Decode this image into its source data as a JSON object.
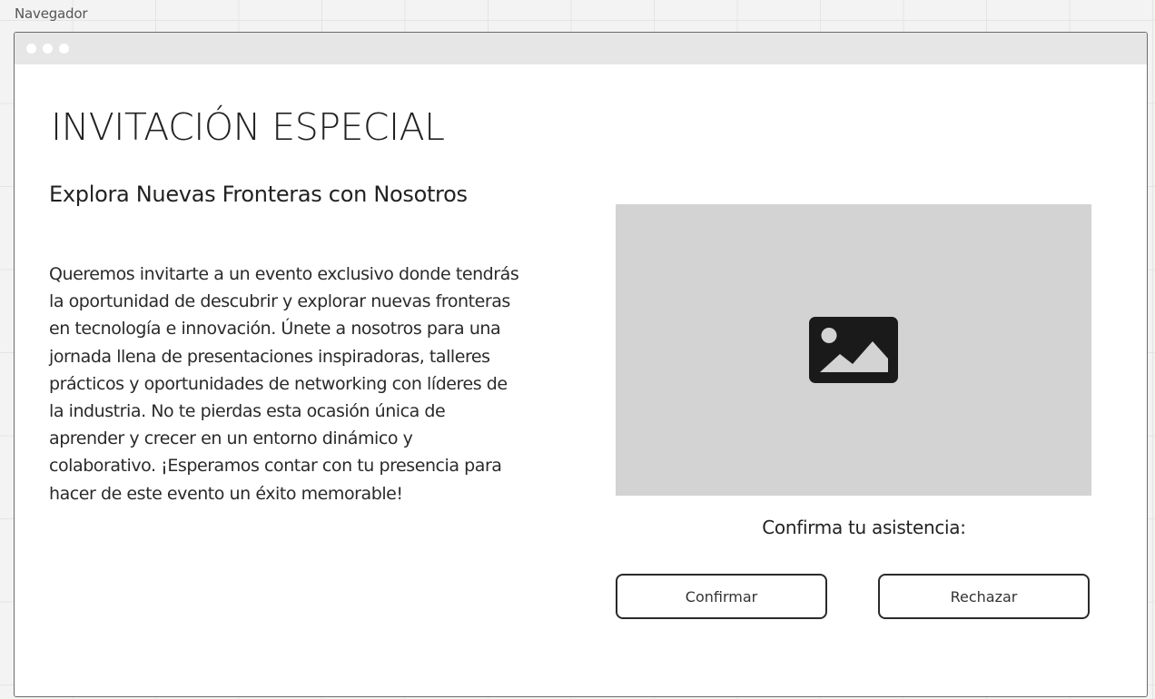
{
  "canvas": {
    "label": "Navegador"
  },
  "page": {
    "title": "INVITACIÓN ESPECIAL",
    "subtitle": "Explora Nuevas Fronteras con Nosotros",
    "body": "Queremos invitarte a un evento exclusivo donde tendrás la oportunidad de descubrir y explorar nuevas fronteras en tecnología e innovación. Únete a nosotros para una jornada llena de presentaciones inspiradoras, talleres prácticos y oportunidades de networking con líderes de la industria. No te pierdas esta ocasión única de aprender y crecer en un entorno dinámico y colaborativo. ¡Esperamos contar con tu presencia para hacer de este evento un éxito memorable!",
    "image_icon": "image-icon",
    "confirm_prompt": "Confirma tu asistencia:",
    "confirm_button": "Confirmar",
    "reject_button": "Rechazar"
  },
  "colors": {
    "canvas_background": "#f3f3f3",
    "title_bar": "#e6e6e6",
    "image_placeholder": "#d3d3d3",
    "text": "#222222",
    "button_border": "#2a2a2a"
  }
}
